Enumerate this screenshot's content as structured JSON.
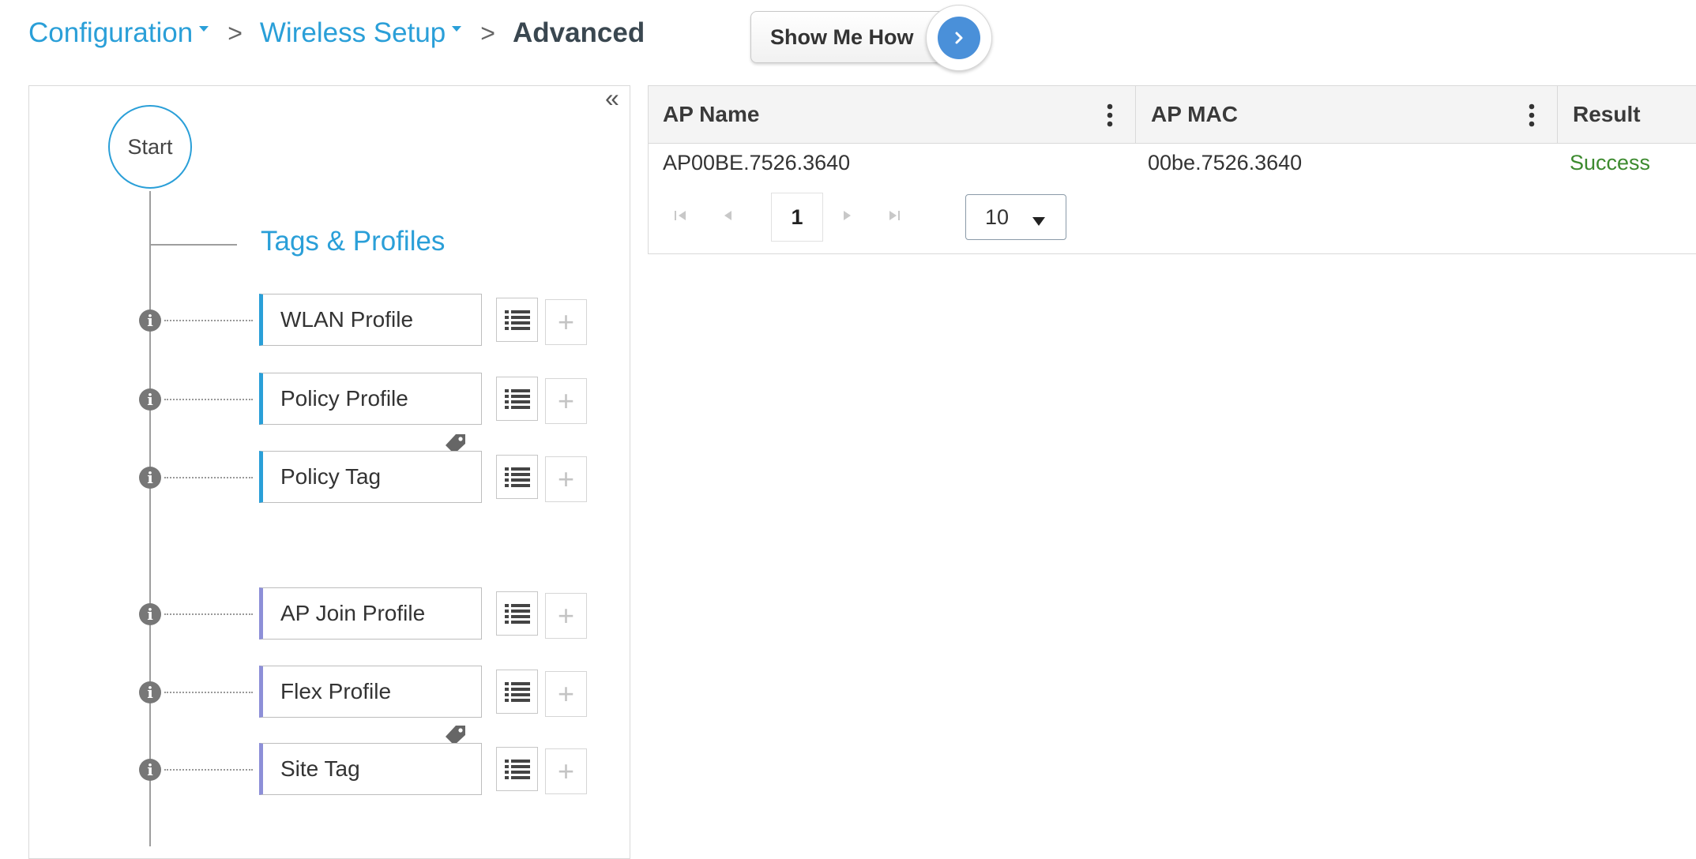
{
  "breadcrumb": {
    "items": [
      {
        "label": "Configuration",
        "has_dropdown": true
      },
      {
        "label": "Wireless Setup",
        "has_dropdown": true
      }
    ],
    "separator": ">",
    "current": "Advanced"
  },
  "show_me_how": {
    "label": "Show Me How",
    "icon": "chevron-right-icon"
  },
  "left_panel": {
    "collapse_glyph": "«",
    "start_label": "Start",
    "section_title": "Tags & Profiles",
    "profiles": [
      {
        "label": "WLAN Profile",
        "accent": "#2a9fd8"
      },
      {
        "label": "Policy Profile",
        "accent": "#2a9fd8",
        "tag_icon": true
      },
      {
        "label": "Policy Tag",
        "accent": "#2a9fd8"
      },
      {
        "label": "AP Join Profile",
        "accent": "#8d8fd8"
      },
      {
        "label": "Flex Profile",
        "accent": "#8d8fd8",
        "tag_icon": true
      },
      {
        "label": "Site Tag",
        "accent": "#8d8fd8"
      }
    ],
    "add_glyph": "+",
    "info_glyph": "i"
  },
  "table": {
    "columns": [
      "AP Name",
      "AP MAC",
      "Result"
    ],
    "rows": [
      {
        "ap_name": "AP00BE.7526.3640",
        "ap_mac": "00be.7526.3640",
        "result": "Success"
      }
    ],
    "pagination": {
      "current_page": "1",
      "page_size": "10"
    }
  },
  "colors": {
    "link": "#2a9fd8",
    "success": "#3c8a2e",
    "accent_purple": "#8d8fd8"
  }
}
